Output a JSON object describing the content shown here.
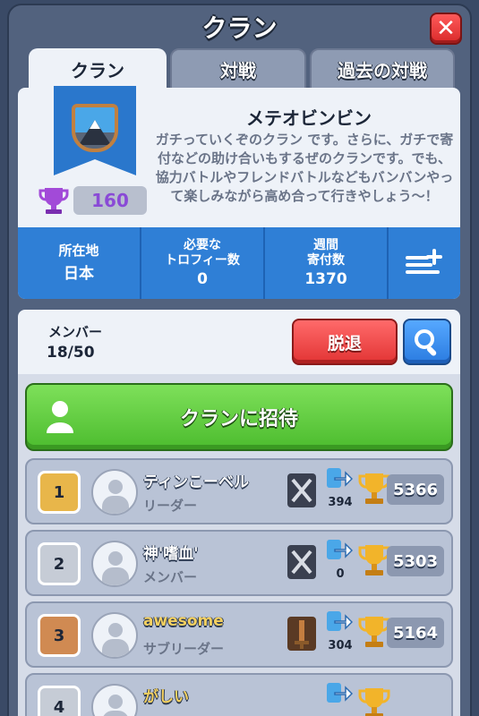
{
  "header": {
    "title": "クラン",
    "close_icon": "close-icon"
  },
  "tabs": [
    {
      "label": "クラン",
      "active": true
    },
    {
      "label": "対戦",
      "active": false
    },
    {
      "label": "過去の対戦",
      "active": false
    }
  ],
  "clan": {
    "name": "メテオビンビン",
    "description": "ガチっていくぞのクラン です。さらに、ガチで寄付などの助け合いもするぜのクランです。でも、協力バトルやフレンドバトルなどもバンバンやって楽しみながら高め合って行きやしょう〜！",
    "trophies": "160",
    "badge_icon": "mountain-shield-badge-icon"
  },
  "stats": {
    "location_label": "所在地",
    "location_value": "日本",
    "required_label_1": "必要な",
    "required_label_2": "トロフィー数",
    "required_value": "0",
    "donations_label_1": "週間",
    "donations_label_2": "寄付数",
    "donations_value": "1370",
    "filter_icon": "list-filter-icon"
  },
  "members_header": {
    "label": "メンバー",
    "count": "18/50",
    "leave_label": "脱退",
    "search_icon": "search-icon"
  },
  "invite": {
    "label": "クランに招待",
    "icon": "person-icon"
  },
  "members": [
    {
      "rank": "1",
      "name": "ティンこーベル",
      "role": "リーダー",
      "donations": "394",
      "trophies": "5366",
      "arena_icon": "crossed-swords-arena-icon"
    },
    {
      "rank": "2",
      "name": "神'嗜血'",
      "role": "メンバー",
      "donations": "0",
      "trophies": "5303",
      "arena_icon": "crossed-swords-arena-icon"
    },
    {
      "rank": "3",
      "name": "awesome",
      "role": "サブリーダー",
      "donations": "304",
      "trophies": "5164",
      "arena_icon": "sword-arena-icon"
    },
    {
      "rank": "4",
      "name": "がしい",
      "role": "",
      "donations": "",
      "trophies": "",
      "arena_icon": "crossed-swords-arena-icon"
    }
  ],
  "colors": {
    "panel": "#52627e",
    "card": "#eef2f8",
    "stats_bar": "#2f7fd6",
    "invite_button": "#5cc83a",
    "leave_button": "#e23434",
    "search_button": "#2a7be0",
    "trophy_count": "#8a4ad6"
  }
}
